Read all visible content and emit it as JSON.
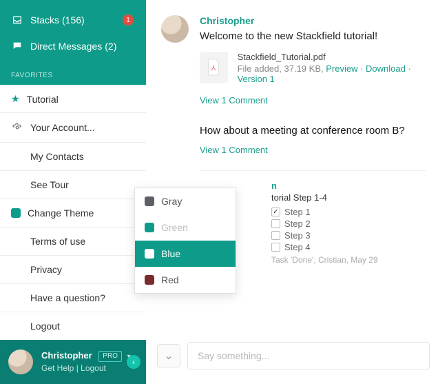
{
  "sidebar": {
    "stacks_label": "Stacks",
    "stacks_count": "(156)",
    "stacks_badge": "1",
    "dm_label": "Direct Messages",
    "dm_count": "(2)",
    "favorites_header": "FAVORITES",
    "fav_item": "Tutorial",
    "menu": {
      "account": "Your Account...",
      "contacts": "My Contacts",
      "tour": "See Tour",
      "theme": "Change Theme",
      "terms": "Terms of use",
      "privacy": "Privacy",
      "question": "Have a question?",
      "logout": "Logout"
    },
    "footer": {
      "username": "Christopher",
      "badge": "PRO",
      "help": "Get Help",
      "logout": "Logout"
    }
  },
  "theme_options": {
    "gray": "Gray",
    "green": "Green",
    "blue": "Blue",
    "red": "Red",
    "colors": {
      "gray": "#5d6066",
      "green": "#0e9b8a",
      "blue": "#ffffff",
      "red": "#7a2b2b"
    }
  },
  "feed": {
    "author": "Christopher",
    "welcome": "Welcome to the new Stackfield tutorial!",
    "file": {
      "name": "Stackfield_Tutorial.pdf",
      "prefix": "File added, ",
      "size": "37.19 KB",
      "preview": "Preview",
      "download": "Download",
      "version": "Version 1"
    },
    "view_comment": "View 1 Comment",
    "post2_msg": "How about a meeting at conference room B?",
    "task": {
      "title_suffix": "torial Step 1-4",
      "step1": "Step 1",
      "step2": "Step 2",
      "step3": "Step 3",
      "step4": "Step 4",
      "meta": "Task 'Done', Cristian, May 29"
    }
  },
  "composer": {
    "placeholder": "Say something..."
  }
}
